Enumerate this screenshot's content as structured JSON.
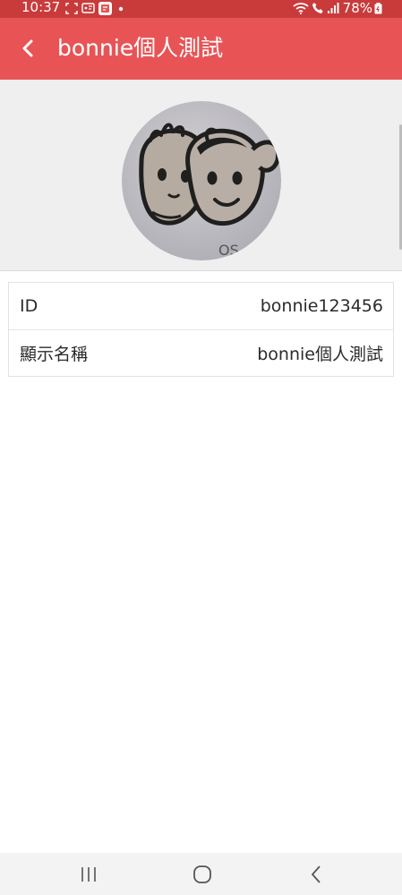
{
  "status_bar": {
    "time": "10:37",
    "battery": "78%",
    "icons": [
      "screenshot-icon",
      "cast-icon",
      "app-notification-icon",
      "dot-icon",
      "wifi-icon",
      "volte-call-icon",
      "signal-icon",
      "battery-icon"
    ]
  },
  "toolbar": {
    "back_icon": "chevron-left-icon",
    "title": "bonnie個人測試"
  },
  "profile": {
    "avatar_alt": "cartoon-kids-avatar"
  },
  "info": {
    "rows": [
      {
        "label": "ID",
        "value": "bonnie123456"
      },
      {
        "label": "顯示名稱",
        "value": "bonnie個人測試"
      }
    ]
  },
  "colors": {
    "status_bar": "#c93b3b",
    "toolbar": "#e85456",
    "header_bg": "#efefef",
    "nav_bg": "#f3f3f3"
  },
  "nav_bar": {
    "buttons": [
      "recent-apps-icon",
      "home-icon",
      "back-icon"
    ]
  }
}
